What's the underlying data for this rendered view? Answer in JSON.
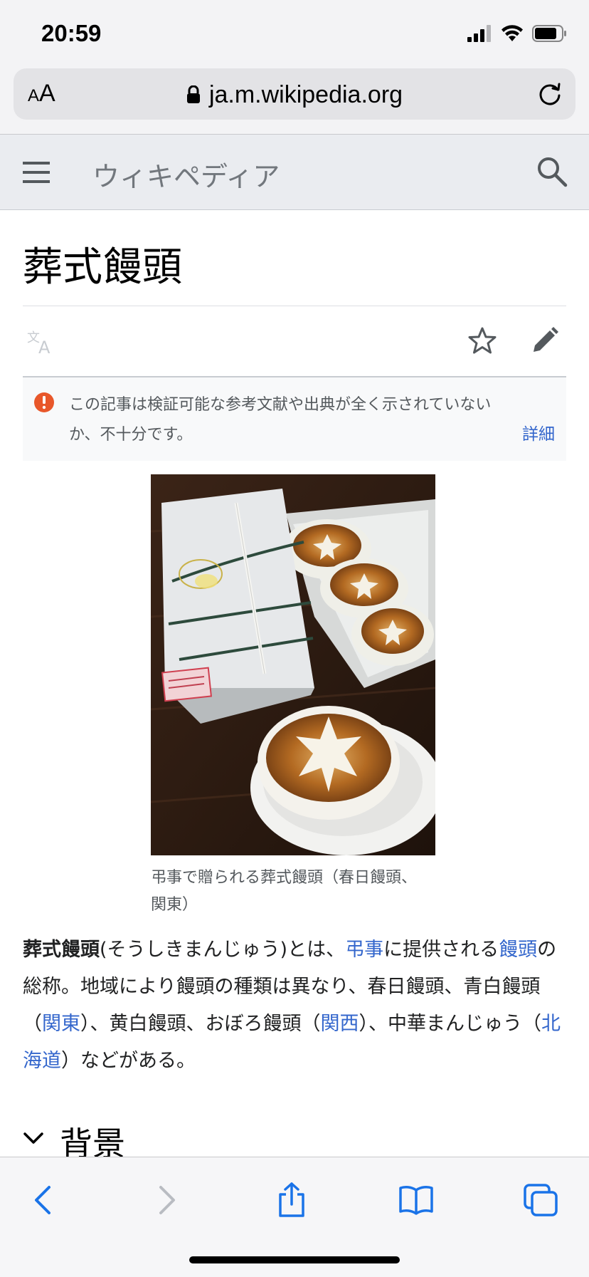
{
  "status_bar": {
    "time": "20:59"
  },
  "browser": {
    "text_size_small": "A",
    "text_size_large": "A",
    "url": "ja.m.wikipedia.org"
  },
  "wiki_header": {
    "logo_text": "ウィキペディア"
  },
  "article": {
    "title": "葬式饅頭",
    "issue_notice": {
      "text": "この記事は検証可能な参考文献や出典が全く示されていないか、不十分です。",
      "more_link": "詳細"
    },
    "image": {
      "caption": "弔事で贈られる葬式饅頭（春日饅頭、関東）"
    },
    "lead": {
      "term": "葬式饅頭",
      "t1": "(そうしきまんじゅう)とは、",
      "link1": "弔事",
      "t2": "に提供される",
      "link2": "饅頭",
      "t3": "の総称。地域により饅頭の種類は異なり、春日饅頭、青白饅頭（",
      "link3": "関東",
      "t4": "）、黄白饅頭、おぼろ饅頭（",
      "link4": "関西",
      "t5": "）、中華まんじゅう（",
      "link5": "北海道",
      "t6": "）などがある。"
    },
    "section": {
      "heading": "背景"
    }
  },
  "colors": {
    "link": "#3366cc",
    "ios_blue": "#1a73e8",
    "warning": "#e8572a"
  }
}
